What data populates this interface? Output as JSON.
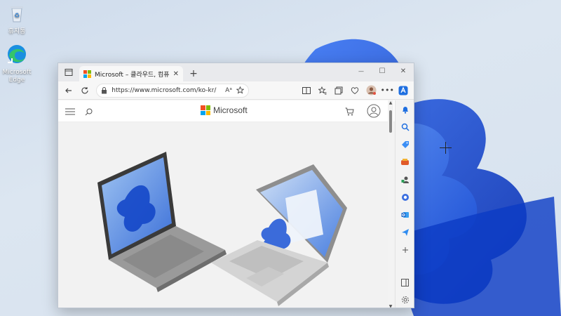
{
  "desktop": {
    "recycle_bin_label": "휴지통",
    "edge_label_line1": "Microsoft",
    "edge_label_line2": "Edge"
  },
  "browser": {
    "tab": {
      "title": "Microsoft – 클라우드, 컴퓨터, 앱",
      "close": "✕"
    },
    "new_tab": "+",
    "window_controls": {
      "minimize": "—",
      "maximize": "☐",
      "close": "✕"
    },
    "address": {
      "url": "https://www.microsoft.com/ko-kr/",
      "read_aloud": "Aᵃ"
    }
  },
  "page": {
    "brand": "Microsoft",
    "logo_colors": [
      "#f25022",
      "#7fba00",
      "#00a4ef",
      "#ffb900"
    ]
  },
  "colors": {
    "accent": "#0067c0",
    "bloom": "#0a4fd6"
  },
  "sidebar_icons": [
    "bell-icon",
    "search-icon",
    "tag-icon",
    "games-icon",
    "people-icon",
    "office-icon",
    "outlook-icon",
    "send-icon",
    "add-icon",
    "split-icon",
    "settings-icon"
  ]
}
